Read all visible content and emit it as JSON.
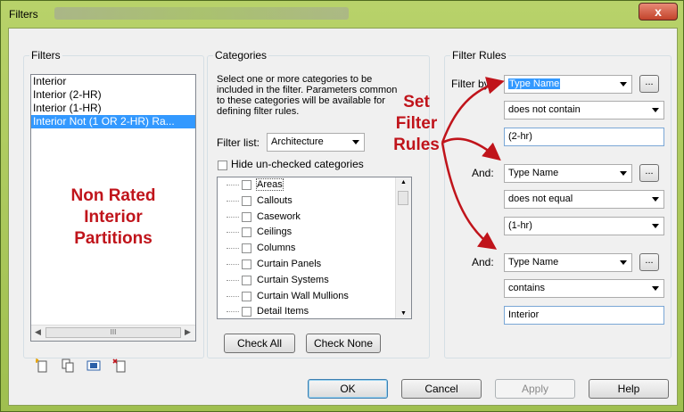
{
  "window": {
    "title": "Filters",
    "close_glyph": "x"
  },
  "filters_group": {
    "label": "Filters",
    "items": [
      "Interior",
      "Interior (2-HR)",
      "Interior (1-HR)",
      "Interior Not (1 OR 2-HR) Ra..."
    ],
    "selected_index": 3,
    "scroll_grip": "III"
  },
  "categories_group": {
    "label": "Categories",
    "description": "Select one or more categories to be included in the filter.  Parameters common to these categories will be available for defining filter rules.",
    "filter_list_label": "Filter list:",
    "filter_list_value": "Architecture",
    "hide_unchecked_label": "Hide un-checked categories",
    "items": [
      "Areas",
      "Callouts",
      "Casework",
      "Ceilings",
      "Columns",
      "Curtain Panels",
      "Curtain Systems",
      "Curtain Wall Mullions",
      "Detail Items"
    ],
    "check_all_label": "Check All",
    "check_none_label": "Check None"
  },
  "filter_rules_group": {
    "label": "Filter Rules",
    "rules": [
      {
        "label": "Filter by:",
        "parameter": "Type Name",
        "operator": "does not contain",
        "value": "(2-hr)"
      },
      {
        "label": "And:",
        "parameter": "Type Name",
        "operator": "does not equal",
        "value": "(1-hr)"
      },
      {
        "label": "And:",
        "parameter": "Type Name",
        "operator": "contains",
        "value": "Interior"
      }
    ],
    "ellipsis_label": "..."
  },
  "annotations": {
    "non_rated": [
      "Non Rated",
      "Interior",
      "Partitions"
    ],
    "set_filter": [
      "Set",
      "Filter",
      "Rules"
    ],
    "annotation_color": "#c0141b"
  },
  "footer": {
    "ok_label": "OK",
    "cancel_label": "Cancel",
    "apply_label": "Apply",
    "help_label": "Help"
  }
}
